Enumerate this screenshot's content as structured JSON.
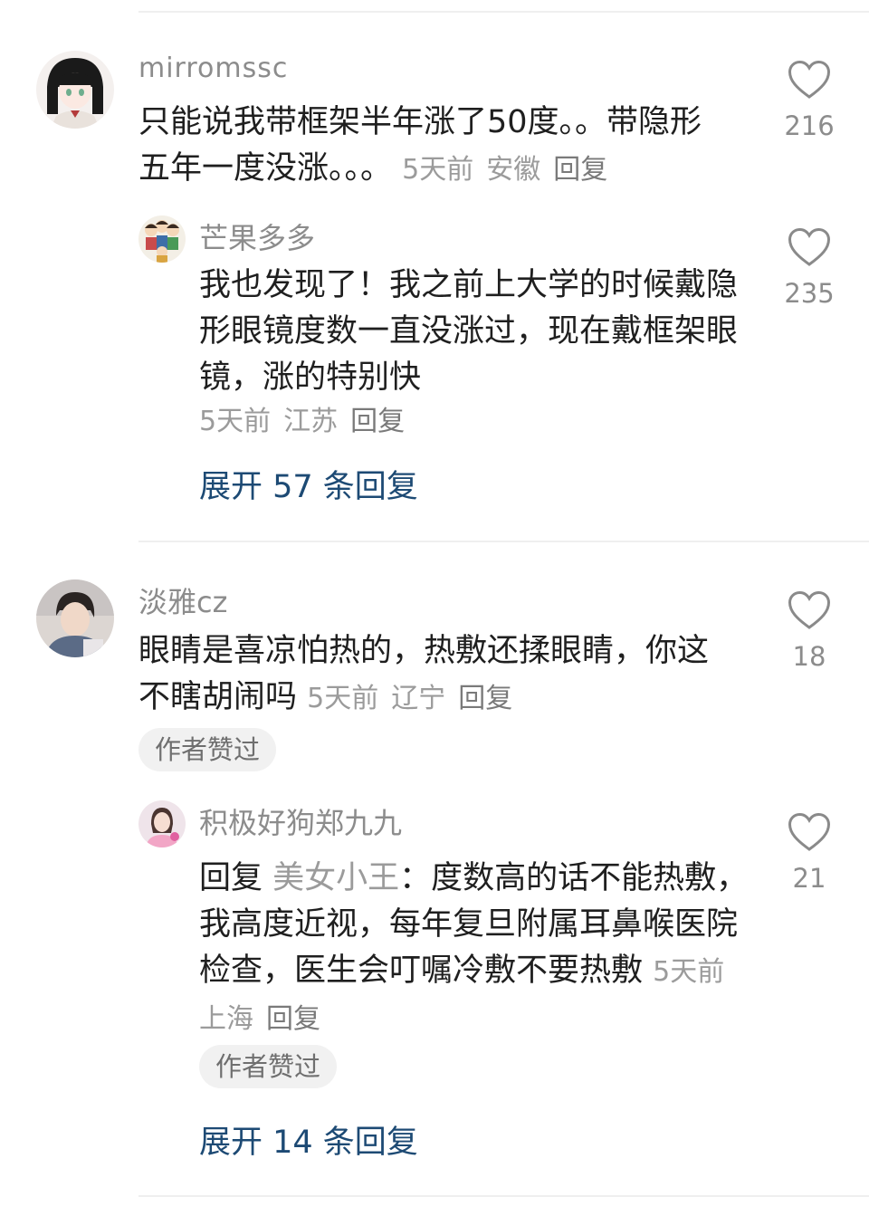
{
  "comments": [
    {
      "username": "mirromssc",
      "text": "只能说我带框架半年涨了50度。。带隐形五年一度没涨。。。",
      "time": "5天前",
      "location": "安徽",
      "reply_label": "回复",
      "likes": "216",
      "reply": {
        "username": "芒果多多",
        "text": "我也发现了！我之前上大学的时候戴隐形眼镜度数一直没涨过，现在戴框架眼镜，涨的特别快",
        "time": "5天前",
        "location": "江苏",
        "reply_label": "回复",
        "likes": "235"
      },
      "expand_label": "展开 57 条回复"
    },
    {
      "username": "淡雅cz",
      "text": "眼睛是喜凉怕热的，热敷还揉眼睛，你这不瞎胡闹吗",
      "time": "5天前",
      "location": "辽宁",
      "reply_label": "回复",
      "likes": "18",
      "author_liked": "作者赞过",
      "reply": {
        "username": "积极好狗郑九九",
        "reply_prefix": "回复",
        "reply_to": "美女小王",
        "text": "：度数高的话不能热敷，我高度近视，每年复旦附属耳鼻喉医院检查，医生会叮嘱冷敷不要热敷",
        "time": "5天前",
        "location": "上海",
        "reply_label": "回复",
        "likes": "21",
        "author_liked": "作者赞过"
      },
      "expand_label": "展开 14 条回复"
    }
  ],
  "icons": {
    "like": "heart-outline-icon"
  },
  "colors": {
    "expand_link": "#1d4a74",
    "meta": "#9b9b9b",
    "username": "#8c8c8c"
  }
}
